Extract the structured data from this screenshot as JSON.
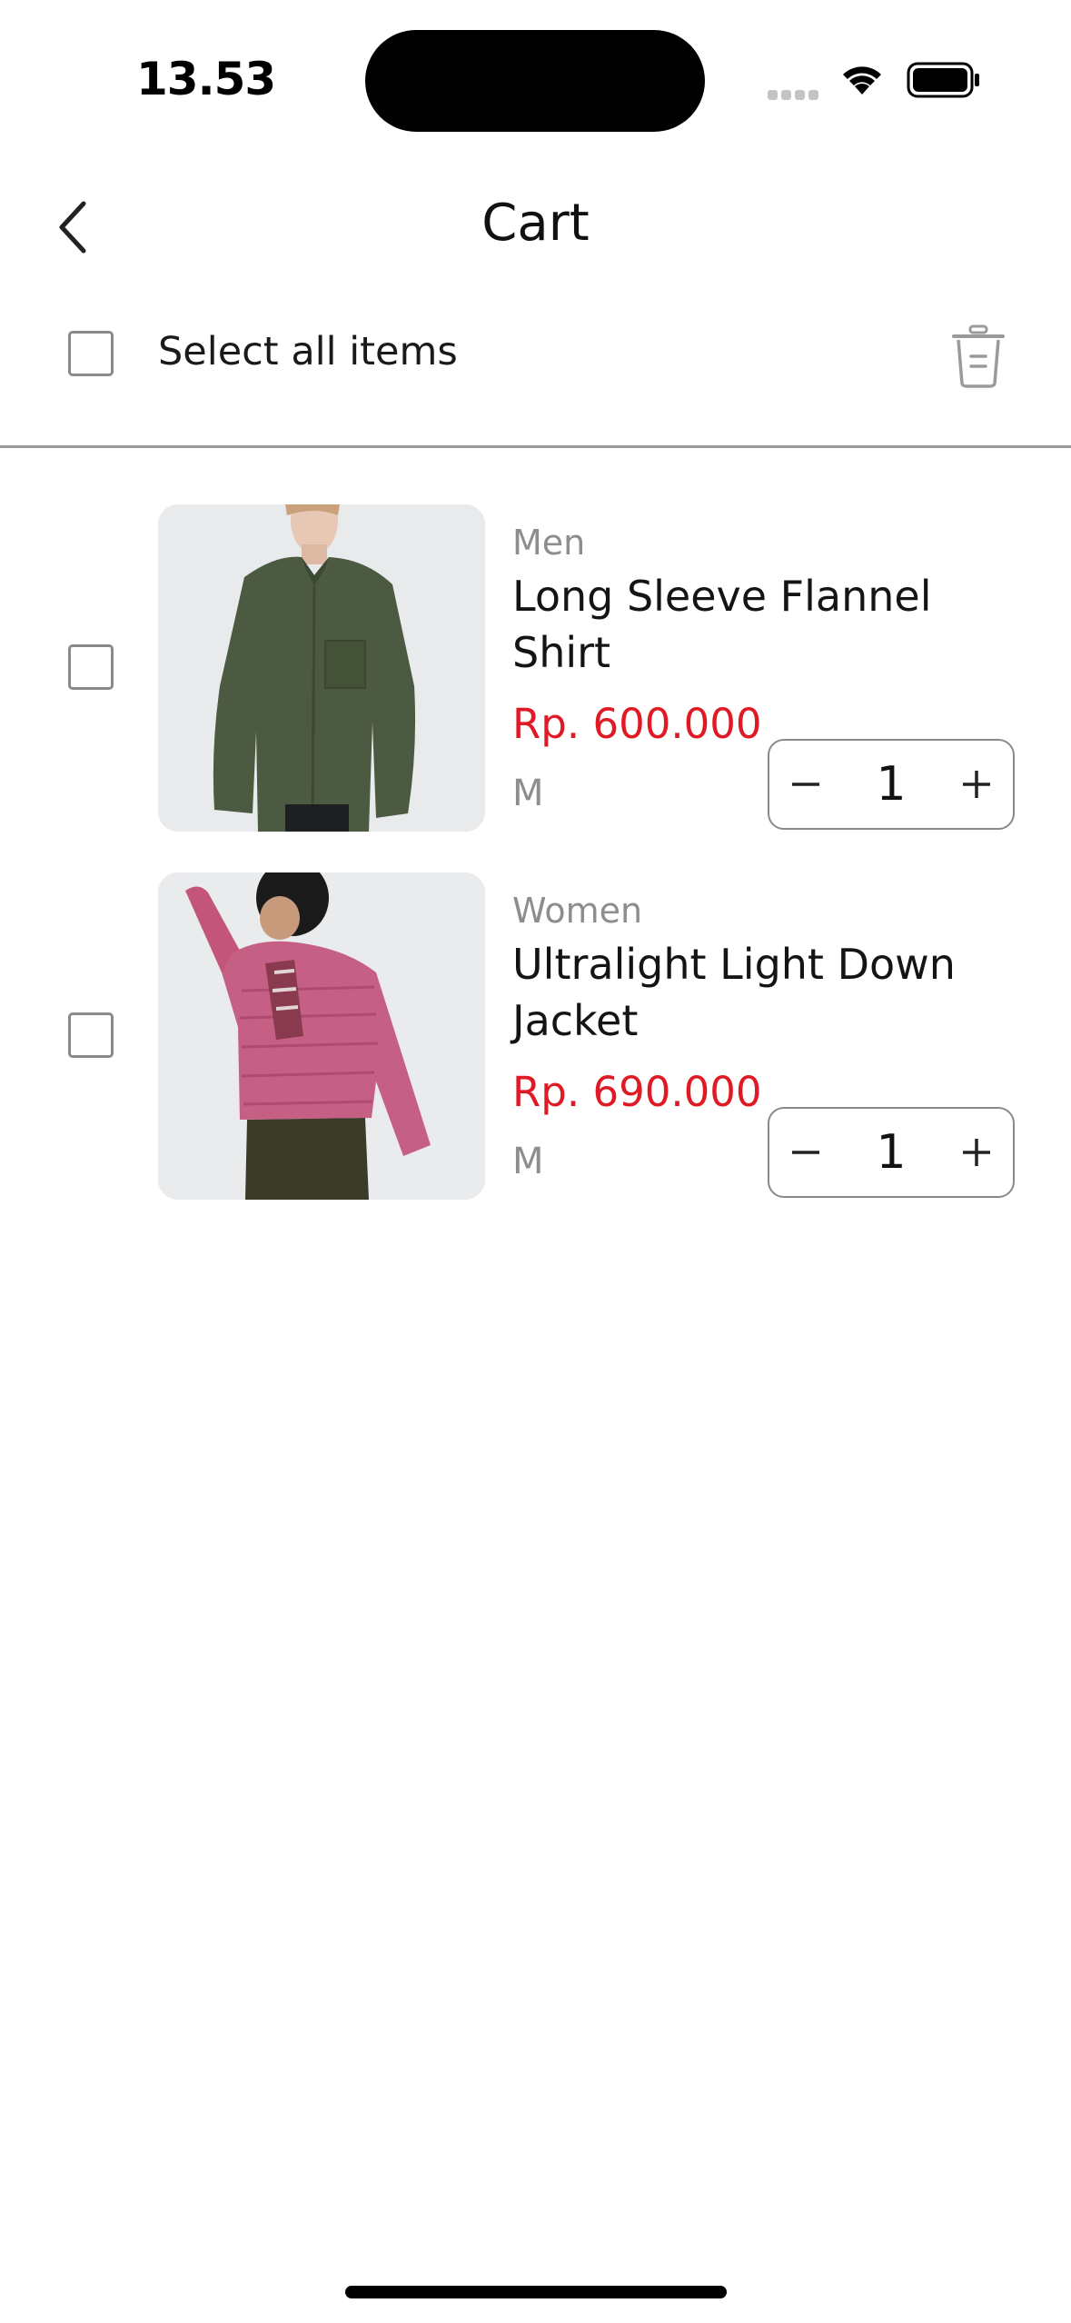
{
  "status_bar": {
    "time": "13.53"
  },
  "nav": {
    "title": "Cart"
  },
  "select_all": {
    "label": "Select all items"
  },
  "items": [
    {
      "category": "Men",
      "name": "Long Sleeve Flannel Shirt",
      "price": "Rp. 600.000",
      "size": "M",
      "quantity": "1",
      "image_desc": "green-flannel-shirt-photo"
    },
    {
      "category": "Women",
      "name": "Ultralight Light Down Jacket",
      "price": "Rp. 690.000",
      "size": "M",
      "quantity": "1",
      "image_desc": "pink-down-jacket-photo"
    }
  ],
  "colors": {
    "price": "#e01a24",
    "muted": "#8d8d8d",
    "border": "#8a8a8a"
  }
}
